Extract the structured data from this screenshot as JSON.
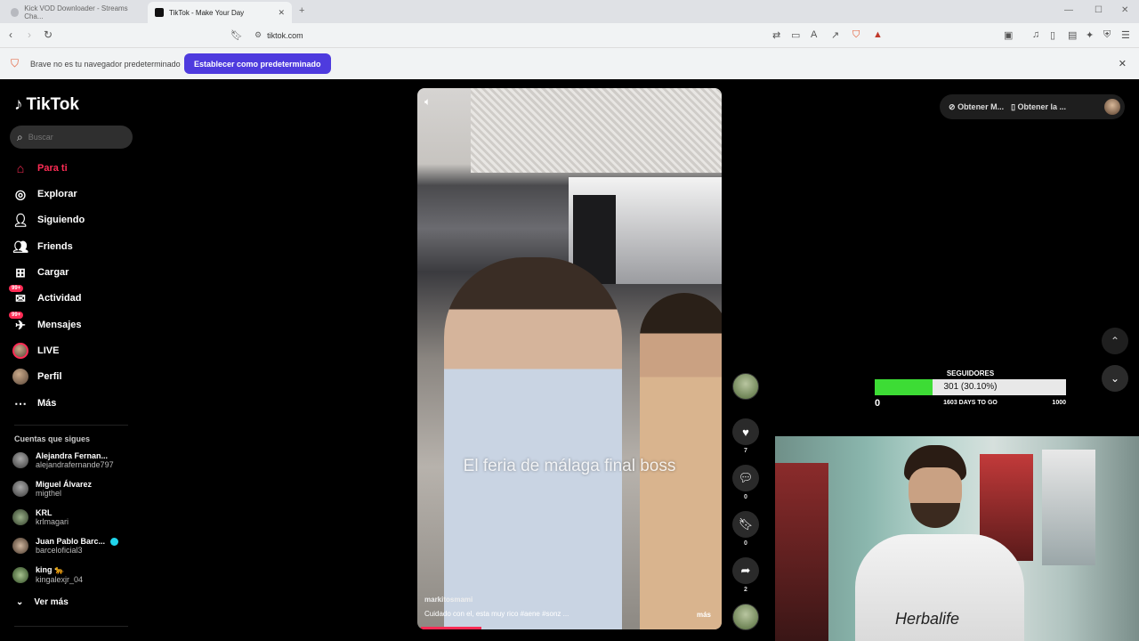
{
  "browser": {
    "tabs": [
      {
        "label": "Kick VOD Downloader - Streams Cha..."
      },
      {
        "label": "TikTok - Make Your Day"
      }
    ],
    "url": "tiktok.com",
    "infobar": {
      "message": "Brave no es tu navegador predeterminado",
      "button": "Establecer como predeterminado"
    }
  },
  "sidebar": {
    "logo": "TikTok",
    "search_placeholder": "Buscar",
    "nav": [
      {
        "label": "Para ti",
        "icon": "home-icon"
      },
      {
        "label": "Explorar",
        "icon": "compass-icon"
      },
      {
        "label": "Siguiendo",
        "icon": "following-icon"
      },
      {
        "label": "Friends",
        "icon": "friends-icon"
      },
      {
        "label": "Cargar",
        "icon": "upload-icon"
      },
      {
        "label": "Actividad",
        "icon": "activity-icon",
        "badge": "99+"
      },
      {
        "label": "Mensajes",
        "icon": "messages-icon",
        "badge": "99+"
      },
      {
        "label": "LIVE",
        "icon": "live-icon"
      },
      {
        "label": "Perfil",
        "icon": "profile-icon"
      },
      {
        "label": "Más",
        "icon": "more-icon"
      }
    ],
    "following_title": "Cuentas que sigues",
    "following": [
      {
        "name": "Alejandra Fernan...",
        "user": "alejandrafernande797"
      },
      {
        "name": "Miguel Álvarez",
        "user": "migthel"
      },
      {
        "name": "KRL",
        "user": "krlmagari"
      },
      {
        "name": "Juan Pablo Barc...",
        "user": "barceloficial3"
      },
      {
        "name": "king 🐆",
        "user": "kingalexjr_04"
      }
    ],
    "see_more": "Ver más"
  },
  "video": {
    "caption": "El feria de málaga final boss",
    "author": "markitosmami",
    "description": "Cuidado con el, esta muy rico #aene #sonz ...",
    "more": "más",
    "progress": 0.2
  },
  "actions": {
    "likes": "7",
    "comments": "0",
    "saves": "0",
    "shares": "2"
  },
  "topbar": {
    "get_coins": "Obtener M...",
    "get_app": "Obtener la ..."
  },
  "overlay": {
    "title": "SEGUIDORES",
    "bar_text": "301 (30.10%)",
    "fraction": 0.301,
    "min": "0",
    "days": "1603 DAYS TO GO",
    "max": "1000",
    "fill_color": "#3ddc35"
  },
  "webcam": {
    "shirt_text": "Herbalife"
  },
  "colors": {
    "brand": "#fe2c55",
    "infobar_button": "#4e3bde"
  }
}
